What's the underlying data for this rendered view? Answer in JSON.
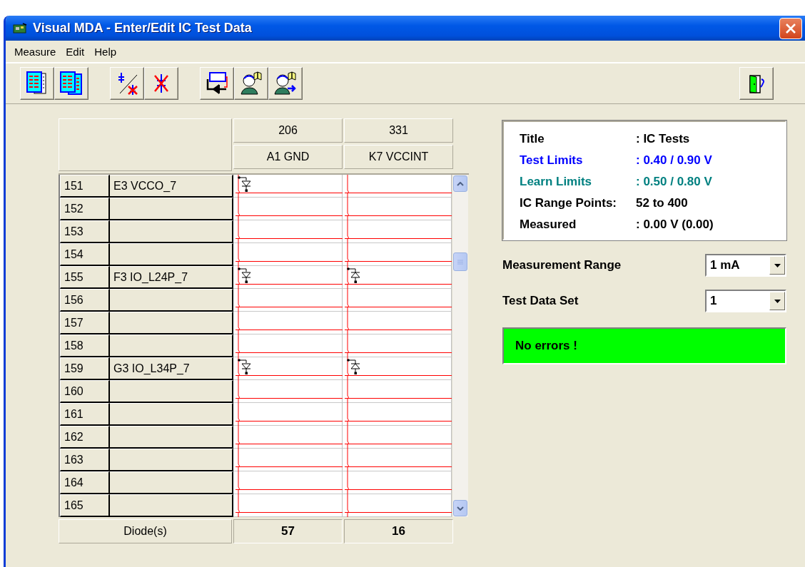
{
  "window": {
    "title": "Visual MDA - Enter/Edit IC Test Data"
  },
  "menu": [
    "Measure",
    "Edit",
    "Help"
  ],
  "grid": {
    "columns": [
      {
        "number": "206",
        "name": "A1 GND"
      },
      {
        "number": "331",
        "name": "K7 VCCINT"
      }
    ],
    "rows": [
      {
        "number": "151",
        "name": "E3 VCCO_7",
        "cells": [
          {
            "kind": "down"
          },
          {
            "kind": "empty"
          }
        ]
      },
      {
        "number": "152",
        "cells": [
          {
            "kind": "empty"
          },
          {
            "kind": "empty"
          }
        ]
      },
      {
        "number": "153",
        "cells": [
          {
            "kind": "empty"
          },
          {
            "kind": "empty"
          }
        ]
      },
      {
        "number": "154",
        "cells": [
          {
            "kind": "empty"
          },
          {
            "kind": "empty"
          }
        ]
      },
      {
        "number": "155",
        "name": "F3 IO_L24P_7",
        "cells": [
          {
            "kind": "down"
          },
          {
            "kind": "up"
          }
        ]
      },
      {
        "number": "156",
        "cells": [
          {
            "kind": "empty"
          },
          {
            "kind": "empty"
          }
        ]
      },
      {
        "number": "157",
        "cells": [
          {
            "kind": "empty"
          },
          {
            "kind": "empty"
          }
        ]
      },
      {
        "number": "158",
        "cells": [
          {
            "kind": "empty"
          },
          {
            "kind": "empty"
          }
        ]
      },
      {
        "number": "159",
        "name": "G3 IO_L34P_7",
        "cells": [
          {
            "kind": "down"
          },
          {
            "kind": "up"
          }
        ]
      },
      {
        "number": "160",
        "cells": [
          {
            "kind": "empty"
          },
          {
            "kind": "empty"
          }
        ]
      },
      {
        "number": "161",
        "cells": [
          {
            "kind": "empty"
          },
          {
            "kind": "empty"
          }
        ]
      },
      {
        "number": "162",
        "cells": [
          {
            "kind": "empty"
          },
          {
            "kind": "empty"
          }
        ]
      },
      {
        "number": "163",
        "cells": [
          {
            "kind": "empty"
          },
          {
            "kind": "empty"
          }
        ]
      },
      {
        "number": "164",
        "cells": [
          {
            "kind": "empty"
          },
          {
            "kind": "empty"
          }
        ]
      },
      {
        "number": "165",
        "cells": [
          {
            "kind": "empty"
          },
          {
            "kind": "empty"
          }
        ]
      }
    ],
    "footer": {
      "label": "Diode(s)",
      "counts": [
        "57",
        "16"
      ]
    }
  },
  "info": [
    {
      "label": "Title",
      "value": ": IC Tests",
      "color": "#000000"
    },
    {
      "label": "Test Limits",
      "value": ": 0.40 / 0.90 V",
      "color": "#0000ff"
    },
    {
      "label": "Learn Limits",
      "value": ": 0.50 / 0.80 V",
      "color": "#008080"
    },
    {
      "label": "IC Range Points:",
      "value": "52 to 400",
      "color": "#000000"
    },
    {
      "label": "Measured",
      "value": ": 0.00 V (0.00)",
      "color": "#000000"
    }
  ],
  "settings": [
    {
      "label": "Measurement Range",
      "value": "1 mA"
    },
    {
      "label": "Test Data Set",
      "value": "1"
    }
  ],
  "status": {
    "message": "No errors !",
    "color": "#00ff00"
  }
}
